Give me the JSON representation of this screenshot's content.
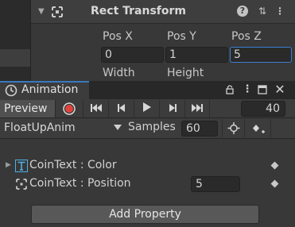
{
  "inspector": {
    "component_title": "Rect Transform",
    "fold_icon": "fold-arrow",
    "component_icon": "rect-transform-icon",
    "header_buttons": [
      "help-icon",
      "preset-icon",
      "more-icon"
    ],
    "help_glyph": "?",
    "preset_glyph": "⇅",
    "more_glyph": "⋮",
    "fields": [
      {
        "label": "Pos X",
        "value": "0"
      },
      {
        "label": "Pos Y",
        "value": "1"
      },
      {
        "label": "Pos Z",
        "value": "5"
      }
    ],
    "sub_labels": [
      "Width",
      "Height"
    ]
  },
  "animation": {
    "tab_label": "Animation",
    "window_buttons": {
      "lock": "lock-icon",
      "menu": "menu-icon",
      "maximize": "maximize-icon",
      "close": "close-icon"
    },
    "menu_glyph": "⋮",
    "close_glyph": "✕",
    "toolbar": {
      "preview_label": "Preview",
      "first_glyph": "⏮",
      "prev_glyph": "⏴",
      "play_glyph": "▶",
      "next_glyph": "⏵",
      "last_glyph": "⏭",
      "frame_value": "40"
    },
    "clip": {
      "name": "FloatUpAnim",
      "samples_label": "Samples",
      "samples_value": "60"
    },
    "properties": [
      {
        "label": "CoinText : Color",
        "icon": "text-icon",
        "has_fold": true,
        "value": null
      },
      {
        "label": "CoinText : Position",
        "icon": "rect-transform-icon",
        "has_fold": false,
        "value": "5"
      }
    ],
    "add_property_label": "Add Property"
  },
  "colors": {
    "record_red": "#e0433a",
    "tab_accent": "#3a79bb",
    "text_icon_blue": "#4fb0e6"
  }
}
